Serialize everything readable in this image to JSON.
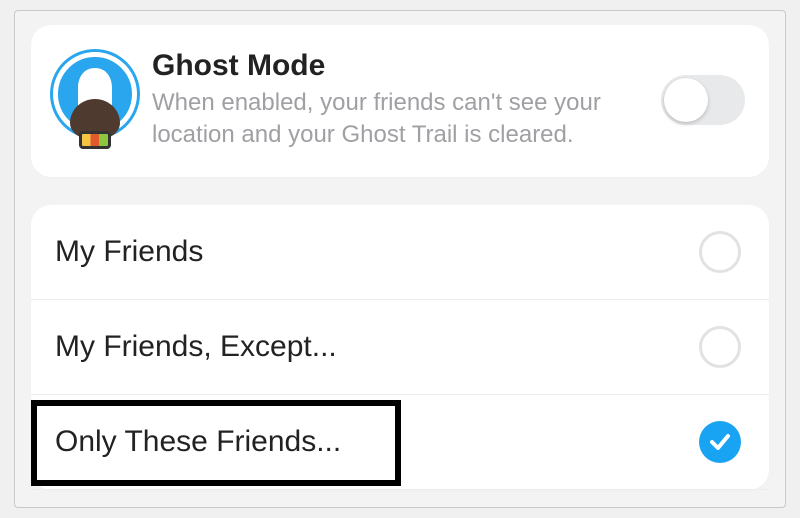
{
  "ghost_mode": {
    "title": "Ghost Mode",
    "description": "When enabled, your friends can't see your location and your Ghost Trail is cleared.",
    "enabled": false
  },
  "options": [
    {
      "label": "My Friends",
      "selected": false
    },
    {
      "label": "My Friends, Except...",
      "selected": false
    },
    {
      "label": "Only These Friends...",
      "selected": true
    }
  ],
  "colors": {
    "accent": "#19a3f3",
    "text_muted": "#9fa0a3"
  }
}
